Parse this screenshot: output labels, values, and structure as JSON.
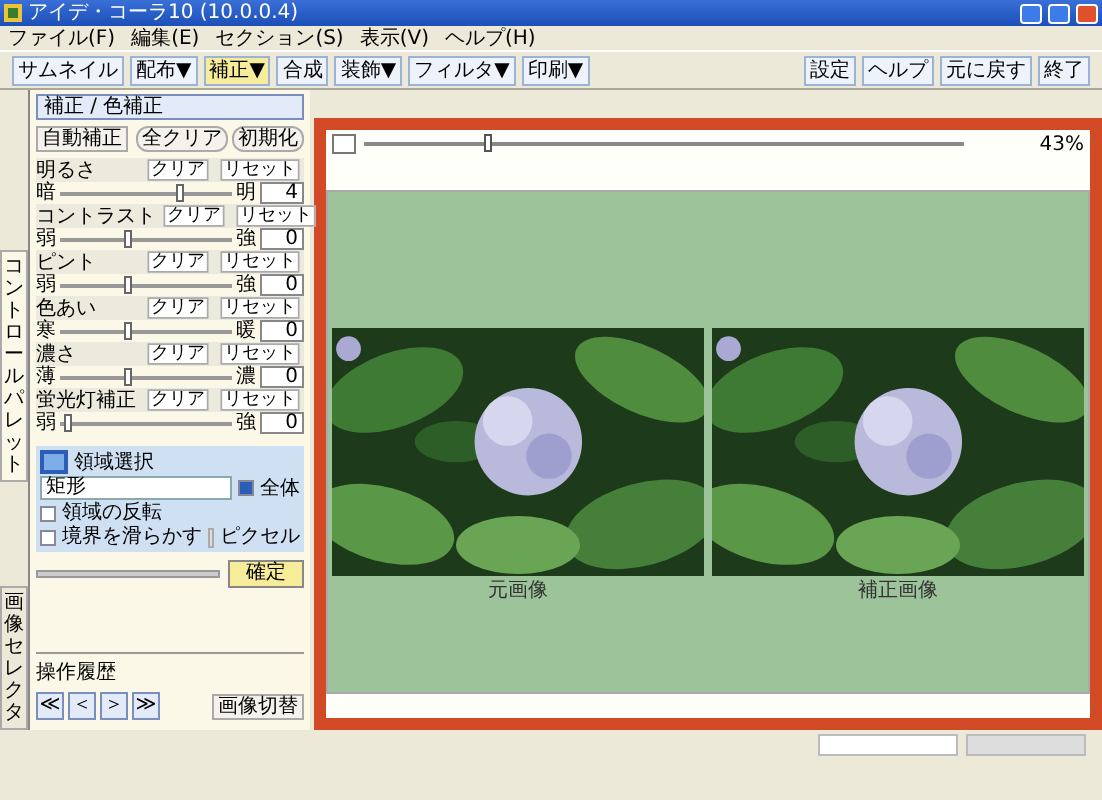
{
  "window": {
    "title": "アイデ・コーラ10 (10.0.0.4)"
  },
  "menu": [
    "ファイル(F)",
    "編集(E)",
    "セクション(S)",
    "表示(V)",
    "ヘルプ(H)"
  ],
  "toolbar": {
    "left": [
      {
        "label": "サムネイル",
        "selected": false
      },
      {
        "label": "配布▼",
        "selected": false
      },
      {
        "label": "補正▼",
        "selected": true
      },
      {
        "label": "合成",
        "selected": false
      },
      {
        "label": "装飾▼",
        "selected": false
      },
      {
        "label": "フィルタ▼",
        "selected": false
      },
      {
        "label": "印刷▼",
        "selected": false
      }
    ],
    "right": [
      "設定",
      "ヘルプ",
      "元に戻す",
      "終了"
    ]
  },
  "side_tabs": [
    {
      "label": "コントロールパレット",
      "selected": true
    },
    {
      "label": "画像セレクタ",
      "selected": false
    }
  ],
  "panel": {
    "title": "補正 / 色補正",
    "auto_button": "自動補正",
    "clear_all": "全クリア",
    "reset_all": "初期化",
    "adjustments": [
      {
        "name": "明るさ",
        "min_label": "暗",
        "max_label": "明",
        "level": 0.7,
        "value": "4",
        "clear": "クリア",
        "reset": "リセット"
      },
      {
        "name": "コントラスト",
        "min_label": "弱",
        "max_label": "強",
        "level": 0.4,
        "value": "0",
        "clear": "クリア",
        "reset": "リセット"
      },
      {
        "name": "ピント",
        "min_label": "弱",
        "max_label": "強",
        "level": 0.4,
        "value": "0",
        "clear": "クリア",
        "reset": "リセット"
      },
      {
        "name": "色あい",
        "min_label": "寒",
        "max_label": "暖",
        "level": 0.4,
        "value": "0",
        "clear": "クリア",
        "reset": "リセット"
      },
      {
        "name": "濃さ",
        "min_label": "薄",
        "max_label": "濃",
        "level": 0.4,
        "value": "0",
        "clear": "クリア",
        "reset": "リセット"
      },
      {
        "name": "蛍光灯補正",
        "min_label": "弱",
        "max_label": "強",
        "level": 0.05,
        "value": "0",
        "clear": "クリア",
        "reset": "リセット"
      }
    ],
    "region": {
      "title": "領域選択",
      "shape": "矩形",
      "whole": {
        "label": "全体",
        "checked": true
      },
      "invert": {
        "label": "領域の反転",
        "checked": false
      },
      "smooth": {
        "label": "境界を滑らかす",
        "checked": false,
        "unit": "ピクセル"
      },
      "apply": "確定"
    },
    "history": {
      "title": "操作履歴",
      "buttons": [
        "≪",
        "＜",
        "＞",
        "≫"
      ],
      "switch": "画像切替"
    }
  },
  "preview": {
    "zoom": {
      "level": 0.2,
      "reading": "43%"
    },
    "images": [
      {
        "caption": "元画像"
      },
      {
        "caption": "補正画像"
      }
    ]
  }
}
